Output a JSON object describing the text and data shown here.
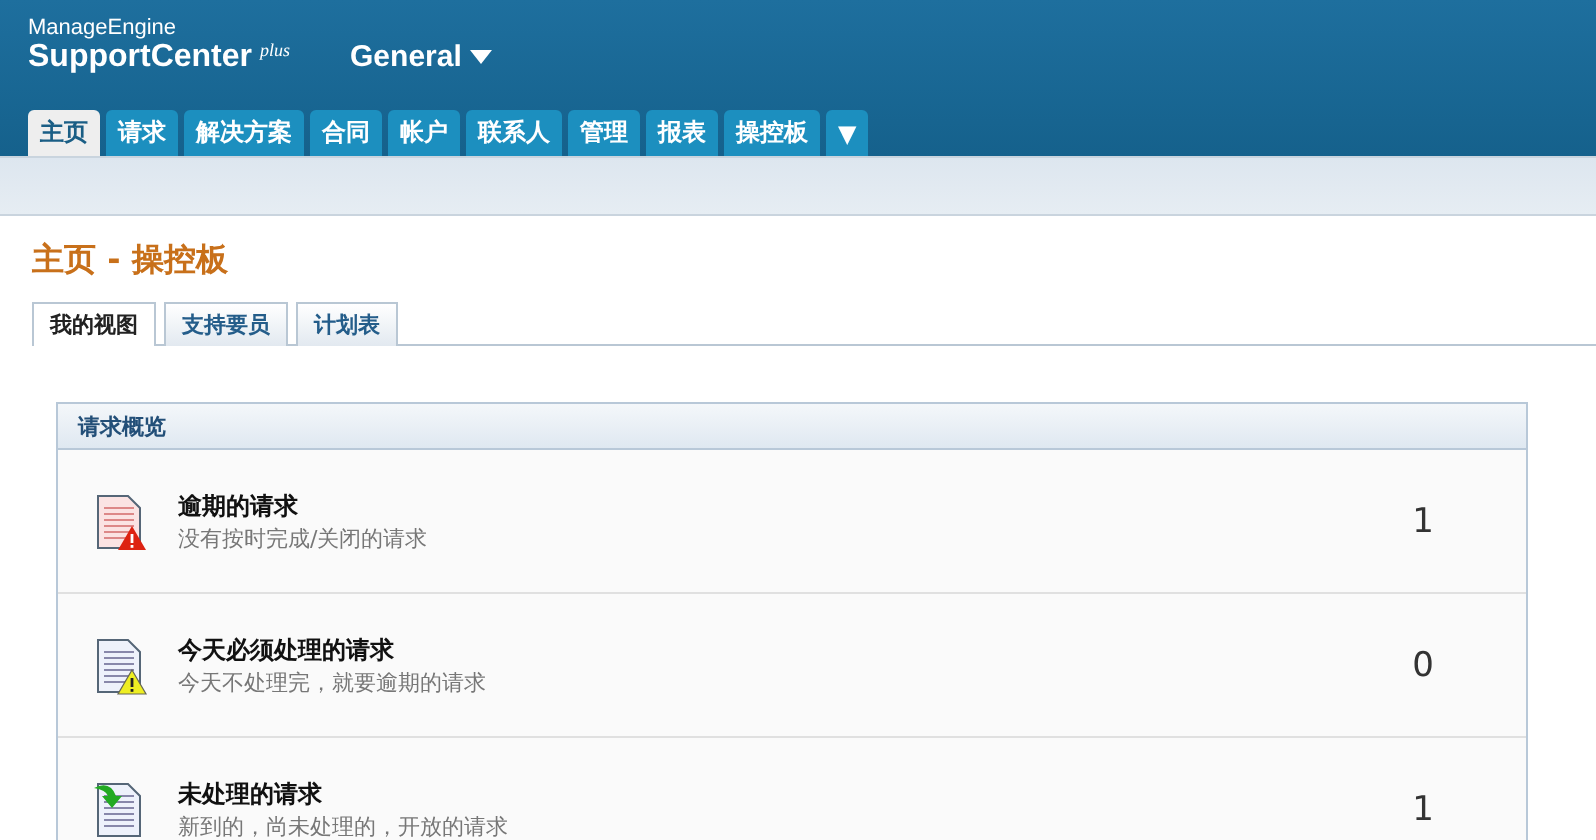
{
  "header": {
    "brand_top": "ManageEngine",
    "brand": "SupportCenter",
    "brand_suffix": "plus",
    "workspace": "General"
  },
  "tabs": [
    {
      "label": "主页",
      "selected": true
    },
    {
      "label": "请求",
      "selected": false
    },
    {
      "label": "解决方案",
      "selected": false
    },
    {
      "label": "合同",
      "selected": false
    },
    {
      "label": "帐户",
      "selected": false
    },
    {
      "label": "联系人",
      "selected": false
    },
    {
      "label": "管理",
      "selected": false
    },
    {
      "label": "报表",
      "selected": false
    },
    {
      "label": "操控板",
      "selected": false
    },
    {
      "label": "▼",
      "selected": false
    }
  ],
  "page_title": "主页 - 操控板",
  "view_tabs": [
    {
      "label": "我的视图",
      "selected": true
    },
    {
      "label": "支持要员",
      "selected": false
    },
    {
      "label": "计划表",
      "selected": false
    }
  ],
  "panel": {
    "title": "请求概览",
    "rows": [
      {
        "kind": "overdue",
        "title": "逾期的请求",
        "subtitle": "没有按时完成/关闭的请求",
        "count": "1"
      },
      {
        "kind": "due_today",
        "title": "今天必须处理的请求",
        "subtitle": "今天不处理完，就要逾期的请求",
        "count": "0"
      },
      {
        "kind": "open",
        "title": "未处理的请求",
        "subtitle": "新到的，尚未处理的，开放的请求",
        "count": "1"
      }
    ]
  }
}
